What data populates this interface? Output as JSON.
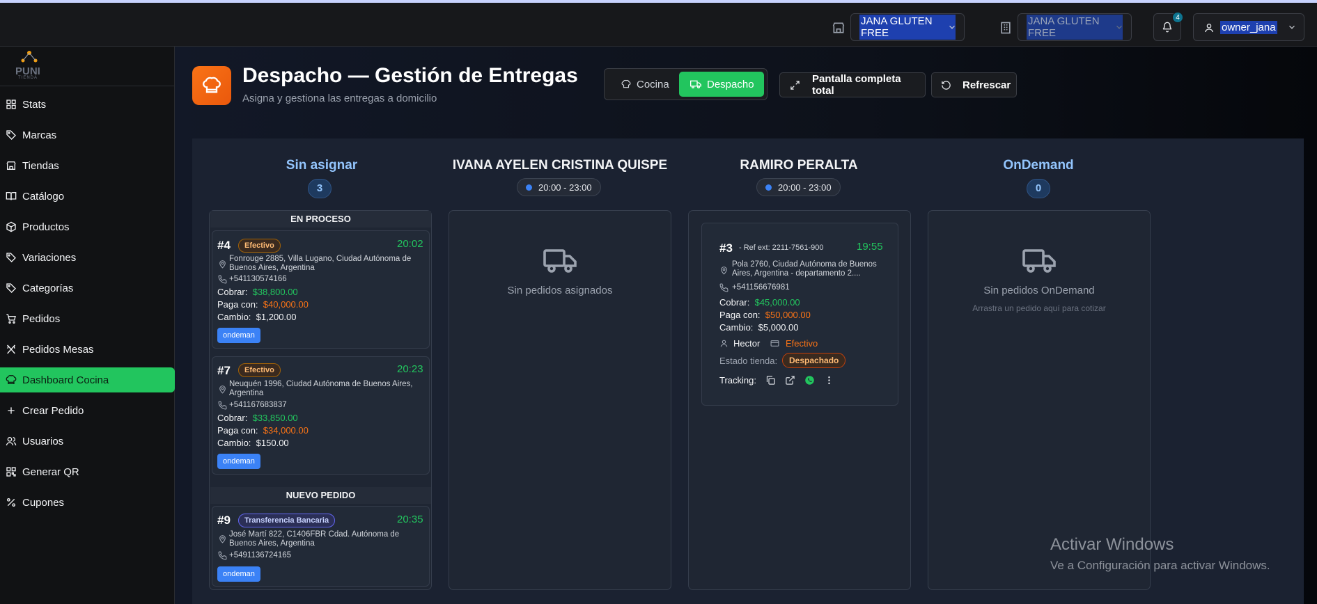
{
  "topbar": {
    "store_select": "JANA GLUTEN FREE",
    "store_select_2": "JANA GLUTEN FREE",
    "notifications_count": "4",
    "user": "owner_jana"
  },
  "sidebar": {
    "logo_text": "PUNI",
    "logo_sub": "TIENDA",
    "items": [
      {
        "label": "Stats",
        "icon": "grid-icon"
      },
      {
        "label": "Marcas",
        "icon": "tag-icon"
      },
      {
        "label": "Tiendas",
        "icon": "store-icon"
      },
      {
        "label": "Catálogo",
        "icon": "book-icon"
      },
      {
        "label": "Productos",
        "icon": "box-icon"
      },
      {
        "label": "Variaciones",
        "icon": "tag-icon"
      },
      {
        "label": "Categorías",
        "icon": "tag-icon"
      },
      {
        "label": "Pedidos",
        "icon": "cart-icon"
      },
      {
        "label": "Pedidos Mesas",
        "icon": "utensils-icon"
      },
      {
        "label": "Dashboard Cocina",
        "icon": "chef-hat-icon",
        "active": true
      },
      {
        "label": "Crear Pedido",
        "icon": "plus-icon"
      },
      {
        "label": "Usuarios",
        "icon": "users-icon"
      },
      {
        "label": "Generar QR",
        "icon": "qr-icon"
      },
      {
        "label": "Cupones",
        "icon": "percent-icon"
      }
    ]
  },
  "header": {
    "title": "Despacho — Gestión de Entregas",
    "subtitle": "Asigna y gestiona las entregas a domicilio",
    "seg_cocina": "Cocina",
    "seg_despacho": "Despacho",
    "fullscreen": "Pantalla completa total",
    "refresh": "Refrescar"
  },
  "colors": {
    "accent_green": "#22c55e",
    "accent_orange": "#f97316",
    "accent_blue": "#3b82f6"
  },
  "columns": {
    "unassigned": {
      "title": "Sin asignar",
      "count": "3",
      "section_in_process": "EN PROCESO",
      "section_new": "NUEVO PEDIDO"
    },
    "driver1": {
      "title": "IVANA AYELEN CRISTINA QUISPE",
      "shift": "20:00 - 23:00",
      "empty": "Sin pedidos asignados"
    },
    "driver2": {
      "title": "RAMIRO PERALTA",
      "shift": "20:00 - 23:00"
    },
    "ondemand": {
      "title": "OnDemand",
      "count": "0",
      "empty": "Sin pedidos OnDemand",
      "hint": "Arrastra un pedido aquí para cotizar"
    }
  },
  "orders": {
    "o4": {
      "num": "#4",
      "payment": "Efectivo",
      "time": "20:02",
      "address_1": "Fonrouge 2885, Villa Lugano, Ciudad Autónoma de",
      "address_2": "Buenos Aires, Argentina",
      "phone": "+541130574166",
      "cobrar_label": "Cobrar:",
      "cobrar": "$38,800.00",
      "paga_label": "Paga con:",
      "paga": "$40,000.00",
      "cambio_label": "Cambio:",
      "cambio": "$1,200.00",
      "tag": "ondeman"
    },
    "o7": {
      "num": "#7",
      "payment": "Efectivo",
      "time": "20:23",
      "address_1": "Neuquén 1996, Ciudad Autónoma de Buenos Aires,",
      "address_2": "Argentina",
      "phone": "+541167683837",
      "cobrar_label": "Cobrar:",
      "cobrar": "$33,850.00",
      "paga_label": "Paga con:",
      "paga": "$34,000.00",
      "cambio_label": "Cambio:",
      "cambio": "$150.00",
      "tag": "ondeman"
    },
    "o9": {
      "num": "#9",
      "payment": "Transferencia Bancaria",
      "time": "20:35",
      "address_1": "José Martí 822, C1406FBR Cdad. Autónoma de",
      "address_2": "Buenos Aires, Argentina",
      "phone": "+5491136724165",
      "tag": "ondeman"
    },
    "o3": {
      "num": "#3",
      "ref": "- Ref ext: 2211-7561-900",
      "time": "19:55",
      "address_1": "Pola 2760, Ciudad Autónoma de Buenos",
      "address_2": "Aires, Argentina - departamento 2....",
      "phone": "+541156676981",
      "cobrar_label": "Cobrar:",
      "cobrar": "$45,000.00",
      "paga_label": "Paga con:",
      "paga": "$50,000.00",
      "cambio_label": "Cambio:",
      "cambio": "$5,000.00",
      "driver": "Hector",
      "payment": "Efectivo",
      "estado_label": "Estado tienda:",
      "estado": "Despachado",
      "tracking_label": "Tracking:"
    }
  },
  "watermark": {
    "line1": "Activar Windows",
    "line2": "Ve a Configuración para activar Windows."
  }
}
